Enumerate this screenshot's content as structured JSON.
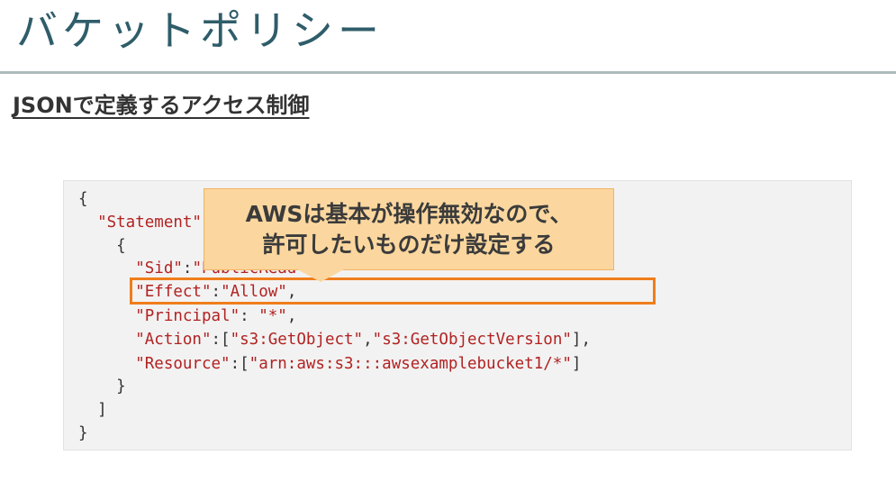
{
  "slide": {
    "title": "バケットポリシー",
    "subheading": "JSONで定義するアクセス制御"
  },
  "code": {
    "lines": [
      [
        {
          "t": "{",
          "c": "punct"
        }
      ],
      [
        {
          "t": "  ",
          "c": "punct"
        },
        {
          "t": "\"Statement\"",
          "c": "str"
        },
        {
          "t": ":[",
          "c": "punct"
        }
      ],
      [
        {
          "t": "    {",
          "c": "punct"
        }
      ],
      [
        {
          "t": "      ",
          "c": "punct"
        },
        {
          "t": "\"Sid\"",
          "c": "str"
        },
        {
          "t": ":",
          "c": "punct"
        },
        {
          "t": "\"PublicRead\"",
          "c": "str"
        },
        {
          "t": ",",
          "c": "punct"
        }
      ],
      [
        {
          "t": "      ",
          "c": "punct"
        },
        {
          "t": "\"Effect\"",
          "c": "str"
        },
        {
          "t": ":",
          "c": "punct"
        },
        {
          "t": "\"Allow\"",
          "c": "str"
        },
        {
          "t": ",",
          "c": "punct"
        }
      ],
      [
        {
          "t": "      ",
          "c": "punct"
        },
        {
          "t": "\"Principal\"",
          "c": "str"
        },
        {
          "t": ": ",
          "c": "punct"
        },
        {
          "t": "\"*\"",
          "c": "str"
        },
        {
          "t": ",",
          "c": "punct"
        }
      ],
      [
        {
          "t": "      ",
          "c": "punct"
        },
        {
          "t": "\"Action\"",
          "c": "str"
        },
        {
          "t": ":[",
          "c": "punct"
        },
        {
          "t": "\"s3:GetObject\"",
          "c": "str"
        },
        {
          "t": ",",
          "c": "punct"
        },
        {
          "t": "\"s3:GetObjectVersion\"",
          "c": "str"
        },
        {
          "t": "],",
          "c": "punct"
        }
      ],
      [
        {
          "t": "      ",
          "c": "punct"
        },
        {
          "t": "\"Resource\"",
          "c": "str"
        },
        {
          "t": ":[",
          "c": "punct"
        },
        {
          "t": "\"arn:aws:s3:::awsexamplebucket1/*\"",
          "c": "str"
        },
        {
          "t": "]",
          "c": "punct"
        }
      ],
      [
        {
          "t": "    }",
          "c": "punct"
        }
      ],
      [
        {
          "t": "  ]",
          "c": "punct"
        }
      ],
      [
        {
          "t": "}",
          "c": "punct"
        }
      ]
    ]
  },
  "callout": {
    "line1": "AWSは基本が操作無効なので、",
    "line2": "許可したいものだけ設定する"
  },
  "colors": {
    "title": "#2f5d6a",
    "code_string": "#b22222",
    "highlight_border": "#f07d1b",
    "callout_fill": "#fbd79f"
  }
}
